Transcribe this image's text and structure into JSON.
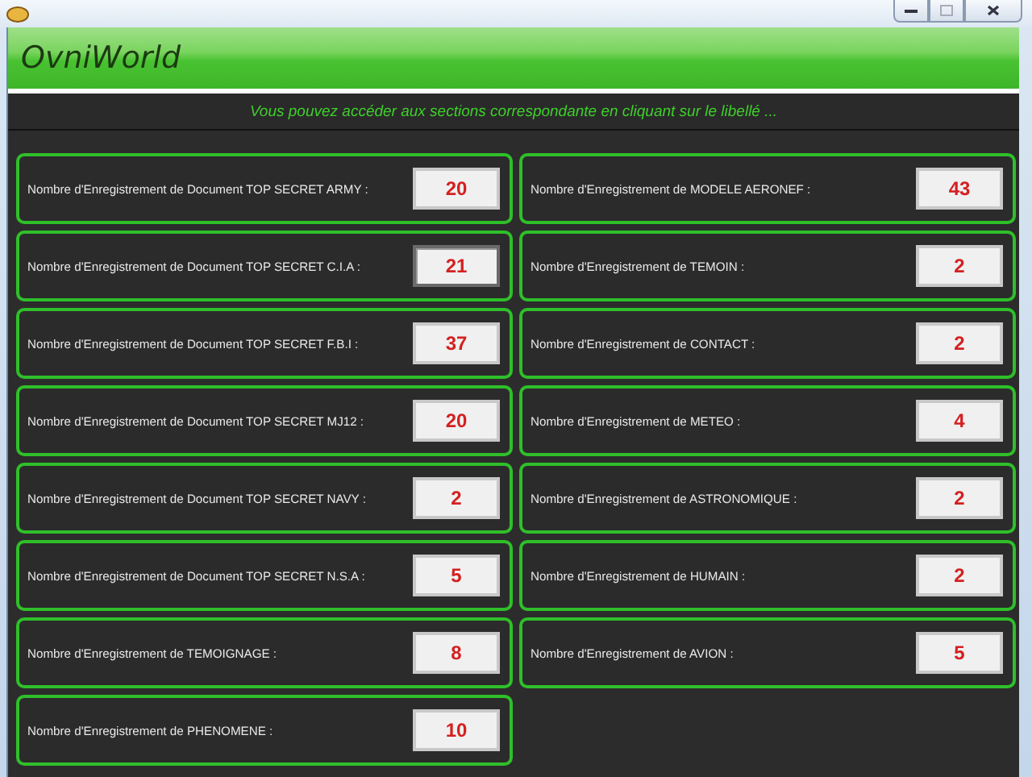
{
  "window": {
    "maximize_disabled": true
  },
  "header": {
    "title": "OvniWorld",
    "subtitle": "Vous pouvez accéder aux sections correspondante en cliquant sur le libellé ..."
  },
  "left": [
    {
      "label": "Nombre d'Enregistrement de Document TOP SECRET ARMY :",
      "value": "20",
      "focused": false
    },
    {
      "label": "Nombre d'Enregistrement de Document TOP SECRET C.I.A :",
      "value": "21",
      "focused": true
    },
    {
      "label": "Nombre d'Enregistrement de Document TOP SECRET F.B.I :",
      "value": "37",
      "focused": false
    },
    {
      "label": "Nombre d'Enregistrement de Document TOP SECRET MJ12 :",
      "value": "20",
      "focused": false
    },
    {
      "label": "Nombre d'Enregistrement de Document TOP SECRET NAVY :",
      "value": "2",
      "focused": false
    },
    {
      "label": "Nombre d'Enregistrement de Document TOP SECRET N.S.A :",
      "value": "5",
      "focused": false
    },
    {
      "label": "Nombre d'Enregistrement de TEMOIGNAGE :",
      "value": "8",
      "focused": false
    },
    {
      "label": "Nombre d'Enregistrement de PHENOMENE :",
      "value": "10",
      "focused": false
    }
  ],
  "right": [
    {
      "label": "Nombre d'Enregistrement de MODELE AERONEF :",
      "value": "43",
      "focused": false
    },
    {
      "label": "Nombre d'Enregistrement de TEMOIN :",
      "value": "2",
      "focused": false
    },
    {
      "label": "Nombre d'Enregistrement de CONTACT :",
      "value": "2",
      "focused": false
    },
    {
      "label": "Nombre d'Enregistrement de METEO :",
      "value": "4",
      "focused": false
    },
    {
      "label": "Nombre d'Enregistrement de ASTRONOMIQUE :",
      "value": "2",
      "focused": false
    },
    {
      "label": "Nombre d'Enregistrement de HUMAIN :",
      "value": "2",
      "focused": false
    },
    {
      "label": "Nombre d'Enregistrement de AVION :",
      "value": "5",
      "focused": false
    }
  ]
}
